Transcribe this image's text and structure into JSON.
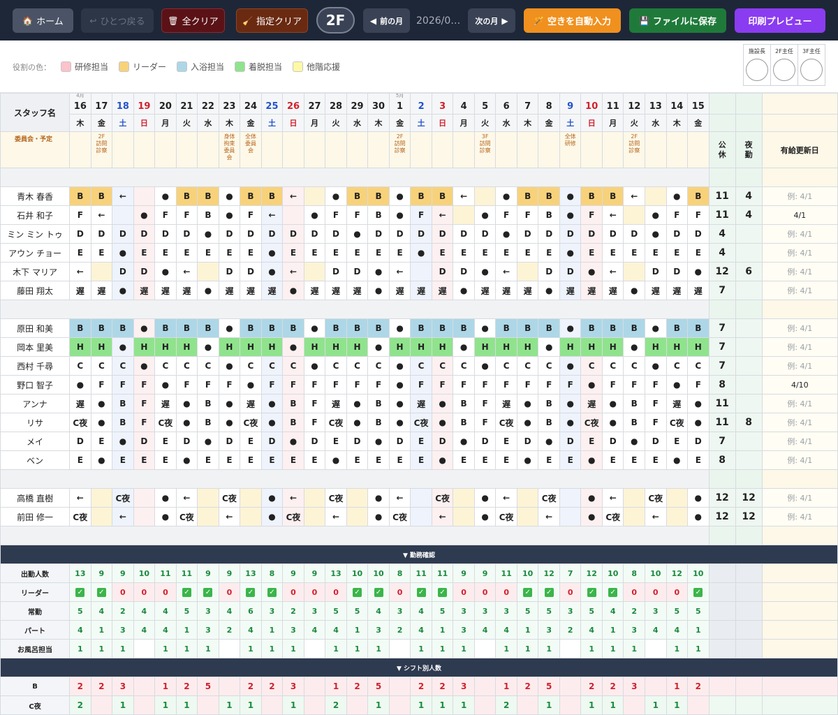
{
  "toolbar": {
    "home": "ホーム",
    "undo": "ひとつ戻る",
    "clear_all": "全クリア",
    "clear_selected": "指定クリア",
    "floor": "2F",
    "prev": "前の月",
    "month": "2026/0…",
    "next": "次の月",
    "auto_fill": "空きを自動入力",
    "save": "ファイルに保存",
    "print": "印刷プレビュー"
  },
  "legend": {
    "title": "役割の色：",
    "items": [
      {
        "label": "研修担当",
        "color": "#fbc3cb"
      },
      {
        "label": "リーダー",
        "color": "#f8d27a"
      },
      {
        "label": "入浴担当",
        "color": "#add7e7"
      },
      {
        "label": "着脱担当",
        "color": "#90e38d"
      },
      {
        "label": "他階応援",
        "color": "#fdf9a6"
      }
    ]
  },
  "stamps": [
    "施設長",
    "2F主任",
    "3F主任"
  ],
  "header": {
    "staff": "スタッフ名",
    "events_label": "委員会・予定",
    "off": "公休",
    "night": "夜勤",
    "paid_update": "有給更新日"
  },
  "days": [
    {
      "n": "16",
      "dow": "木",
      "mo": "4月",
      "t": "wk"
    },
    {
      "n": "17",
      "dow": "金",
      "t": "wk"
    },
    {
      "n": "18",
      "dow": "土",
      "t": "sat"
    },
    {
      "n": "19",
      "dow": "日",
      "t": "sun"
    },
    {
      "n": "20",
      "dow": "月",
      "t": "wk"
    },
    {
      "n": "21",
      "dow": "火",
      "t": "wk"
    },
    {
      "n": "22",
      "dow": "水",
      "t": "wk"
    },
    {
      "n": "23",
      "dow": "木",
      "t": "wk"
    },
    {
      "n": "24",
      "dow": "金",
      "t": "wk"
    },
    {
      "n": "25",
      "dow": "土",
      "t": "sat"
    },
    {
      "n": "26",
      "dow": "日",
      "t": "sun"
    },
    {
      "n": "27",
      "dow": "月",
      "t": "wk"
    },
    {
      "n": "28",
      "dow": "火",
      "t": "wk"
    },
    {
      "n": "29",
      "dow": "水",
      "t": "wk"
    },
    {
      "n": "30",
      "dow": "木",
      "t": "wk"
    },
    {
      "n": "1",
      "dow": "金",
      "mo": "5月",
      "t": "wk"
    },
    {
      "n": "2",
      "dow": "土",
      "t": "sat"
    },
    {
      "n": "3",
      "dow": "日",
      "t": "sun"
    },
    {
      "n": "4",
      "dow": "月",
      "t": "wk"
    },
    {
      "n": "5",
      "dow": "火",
      "t": "wk"
    },
    {
      "n": "6",
      "dow": "水",
      "t": "wk"
    },
    {
      "n": "7",
      "dow": "木",
      "t": "wk"
    },
    {
      "n": "8",
      "dow": "金",
      "t": "wk"
    },
    {
      "n": "9",
      "dow": "土",
      "t": "sat"
    },
    {
      "n": "10",
      "dow": "日",
      "t": "sun"
    },
    {
      "n": "11",
      "dow": "月",
      "t": "wk"
    },
    {
      "n": "12",
      "dow": "火",
      "t": "wk"
    },
    {
      "n": "13",
      "dow": "水",
      "t": "wk"
    },
    {
      "n": "14",
      "dow": "木",
      "t": "wk"
    },
    {
      "n": "15",
      "dow": "金",
      "t": "wk"
    }
  ],
  "events": [
    "",
    "2F訪問診察",
    "",
    "",
    "",
    "",
    "",
    "身体拘束委員会",
    "全体委員会",
    "",
    "",
    "",
    "",
    "",
    "",
    "2F訪問診察",
    "",
    "",
    "",
    "3F訪問診察",
    "",
    "",
    "",
    "全体研修",
    "",
    "",
    "2F訪問診察",
    "",
    "",
    ""
  ],
  "groups": [
    {
      "rows": [
        {
          "name": "青木 春香",
          "cells": [
            "B",
            "B",
            "←",
            "",
            "●",
            "B",
            "B",
            "●",
            "B",
            "B",
            "←",
            "",
            "●",
            "B",
            "B",
            "●",
            "B",
            "B",
            "←",
            "",
            "●",
            "B",
            "B",
            "●",
            "B",
            "B",
            "←",
            "",
            "●",
            "B"
          ],
          "off": "11",
          "night": "4",
          "upd": "例: 4/1",
          "set": false,
          "role": "leader"
        },
        {
          "name": "石井 和子",
          "cells": [
            "F",
            "←",
            "",
            "●",
            "F",
            "F",
            "B",
            "●",
            "F",
            "←",
            "",
            "●",
            "F",
            "F",
            "B",
            "●",
            "F",
            "←",
            "",
            "●",
            "F",
            "F",
            "B",
            "●",
            "F",
            "←",
            "",
            "●",
            "F",
            "F"
          ],
          "off": "11",
          "night": "4",
          "upd": "4/1",
          "set": true
        },
        {
          "name": "ミン ミン トゥ",
          "cells": [
            "D",
            "D",
            "D",
            "D",
            "D",
            "D",
            "●",
            "D",
            "D",
            "D",
            "D",
            "D",
            "D",
            "●",
            "D",
            "D",
            "D",
            "D",
            "D",
            "D",
            "●",
            "D",
            "D",
            "D",
            "D",
            "D",
            "D",
            "●",
            "D",
            "D"
          ],
          "off": "4",
          "night": "",
          "upd": "例: 4/1",
          "set": false
        },
        {
          "name": "アウン チョー",
          "cells": [
            "E",
            "E",
            "●",
            "E",
            "E",
            "E",
            "E",
            "E",
            "E",
            "●",
            "E",
            "E",
            "E",
            "E",
            "E",
            "E",
            "●",
            "E",
            "E",
            "E",
            "E",
            "E",
            "E",
            "●",
            "E",
            "E",
            "E",
            "E",
            "E",
            "E"
          ],
          "off": "4",
          "night": "",
          "upd": "例: 4/1",
          "set": false
        },
        {
          "name": "木下 マリア",
          "cells": [
            "←",
            "",
            "D",
            "D",
            "●",
            "←",
            "",
            "D",
            "D",
            "●",
            "←",
            "",
            "D",
            "D",
            "●",
            "←",
            "",
            "D",
            "D",
            "●",
            "←",
            "",
            "D",
            "D",
            "●",
            "←",
            "",
            "D",
            "D",
            "●"
          ],
          "off": "12",
          "night": "6",
          "upd": "例: 4/1",
          "set": false
        },
        {
          "name": "藤田 翔太",
          "cells": [
            "遅",
            "遅",
            "●",
            "遅",
            "遅",
            "遅",
            "●",
            "遅",
            "遅",
            "遅",
            "●",
            "遅",
            "遅",
            "遅",
            "●",
            "遅",
            "遅",
            "遅",
            "●",
            "遅",
            "遅",
            "遅",
            "●",
            "遅",
            "遅",
            "遅",
            "●",
            "遅",
            "遅",
            "遅"
          ],
          "off": "7",
          "night": "",
          "upd": "例: 4/1",
          "set": false
        }
      ]
    },
    {
      "rows": [
        {
          "name": "原田 和美",
          "cells": [
            "B",
            "B",
            "B",
            "●",
            "B",
            "B",
            "B",
            "●",
            "B",
            "B",
            "B",
            "●",
            "B",
            "B",
            "B",
            "●",
            "B",
            "B",
            "B",
            "●",
            "B",
            "B",
            "B",
            "●",
            "B",
            "B",
            "B",
            "●",
            "B",
            "B"
          ],
          "off": "7",
          "night": "",
          "upd": "例: 4/1",
          "set": false,
          "role": "bath"
        },
        {
          "name": "岡本 里美",
          "cells": [
            "H",
            "H",
            "●",
            "H",
            "H",
            "H",
            "●",
            "H",
            "H",
            "H",
            "●",
            "H",
            "H",
            "H",
            "●",
            "H",
            "H",
            "H",
            "●",
            "H",
            "H",
            "H",
            "●",
            "H",
            "H",
            "H",
            "●",
            "H",
            "H",
            "H"
          ],
          "off": "7",
          "night": "",
          "upd": "例: 4/1",
          "set": false,
          "role": "dress"
        },
        {
          "name": "西村 千尋",
          "cells": [
            "C",
            "C",
            "C",
            "●",
            "C",
            "C",
            "C",
            "●",
            "C",
            "C",
            "C",
            "●",
            "C",
            "C",
            "C",
            "●",
            "C",
            "C",
            "C",
            "●",
            "C",
            "C",
            "C",
            "●",
            "C",
            "C",
            "C",
            "●",
            "C",
            "C"
          ],
          "off": "7",
          "night": "",
          "upd": "例: 4/1",
          "set": false
        },
        {
          "name": "野口 智子",
          "cells": [
            "●",
            "F",
            "F",
            "F",
            "●",
            "F",
            "F",
            "F",
            "●",
            "F",
            "F",
            "F",
            "F",
            "F",
            "F",
            "●",
            "F",
            "F",
            "F",
            "F",
            "F",
            "F",
            "F",
            "F",
            "●",
            "F",
            "F",
            "F",
            "●",
            "F"
          ],
          "off": "8",
          "night": "",
          "upd": "4/10",
          "set": true
        },
        {
          "name": "アンナ",
          "cells": [
            "遅",
            "●",
            "B",
            "F",
            "遅",
            "●",
            "B",
            "●",
            "遅",
            "●",
            "B",
            "F",
            "遅",
            "●",
            "B",
            "●",
            "遅",
            "●",
            "B",
            "F",
            "遅",
            "●",
            "B",
            "●",
            "遅",
            "●",
            "B",
            "F",
            "遅",
            "●"
          ],
          "off": "11",
          "night": "",
          "upd": "例: 4/1",
          "set": false
        },
        {
          "name": "リサ",
          "cells": [
            "C夜",
            "●",
            "B",
            "F",
            "C夜",
            "●",
            "B",
            "●",
            "C夜",
            "●",
            "B",
            "F",
            "C夜",
            "●",
            "B",
            "●",
            "C夜",
            "●",
            "B",
            "F",
            "C夜",
            "●",
            "B",
            "●",
            "C夜",
            "●",
            "B",
            "F",
            "C夜",
            "●"
          ],
          "off": "11",
          "night": "8",
          "upd": "例: 4/1",
          "set": false
        },
        {
          "name": "メイ",
          "cells": [
            "D",
            "E",
            "●",
            "D",
            "E",
            "D",
            "●",
            "D",
            "E",
            "D",
            "●",
            "D",
            "E",
            "D",
            "●",
            "D",
            "E",
            "D",
            "●",
            "D",
            "E",
            "D",
            "●",
            "D",
            "E",
            "D",
            "●",
            "D",
            "E",
            "D"
          ],
          "off": "7",
          "night": "",
          "upd": "例: 4/1",
          "set": false
        },
        {
          "name": "ベン",
          "cells": [
            "E",
            "●",
            "E",
            "E",
            "E",
            "●",
            "E",
            "E",
            "E",
            "E",
            "E",
            "E",
            "●",
            "E",
            "E",
            "E",
            "E",
            "●",
            "E",
            "E",
            "E",
            "●",
            "E",
            "E",
            "●",
            "E",
            "E",
            "E",
            "●",
            "E"
          ],
          "off": "8",
          "night": "",
          "upd": "例: 4/1",
          "set": false
        }
      ]
    },
    {
      "rows": [
        {
          "name": "高橋 直樹",
          "cells": [
            "←",
            "",
            "C夜",
            "",
            "●",
            "←",
            "",
            "C夜",
            "",
            "●",
            "←",
            "",
            "C夜",
            "",
            "●",
            "←",
            "",
            "C夜",
            "",
            "●",
            "←",
            "",
            "C夜",
            "",
            "●",
            "←",
            "",
            "C夜",
            "",
            "●"
          ],
          "off": "12",
          "night": "12",
          "upd": "例: 4/1",
          "set": false
        },
        {
          "name": "前田 修一",
          "cells": [
            "C夜",
            "",
            "←",
            "",
            "●",
            "C夜",
            "",
            "←",
            "",
            "●",
            "C夜",
            "",
            "←",
            "",
            "●",
            "C夜",
            "",
            "←",
            "",
            "●",
            "C夜",
            "",
            "←",
            "",
            "●",
            "C夜",
            "",
            "←",
            "",
            "●"
          ],
          "off": "12",
          "night": "12",
          "upd": "例: 4/1",
          "set": false
        }
      ]
    }
  ],
  "attendance": {
    "title": "▼ 勤務確認",
    "rows": [
      {
        "label": "出勤人数",
        "values": [
          "13",
          "9",
          "9",
          "10",
          "11",
          "11",
          "9",
          "9",
          "13",
          "8",
          "9",
          "9",
          "13",
          "10",
          "10",
          "8",
          "11",
          "11",
          "9",
          "9",
          "11",
          "10",
          "12",
          "7",
          "12",
          "10",
          "8",
          "10",
          "12",
          "10"
        ]
      },
      {
        "label": "リーダー",
        "values": [
          "✓",
          "✓",
          "0",
          "0",
          "0",
          "✓",
          "✓",
          "0",
          "✓",
          "✓",
          "0",
          "0",
          "0",
          "✓",
          "✓",
          "0",
          "✓",
          "✓",
          "0",
          "0",
          "0",
          "✓",
          "✓",
          "0",
          "✓",
          "✓",
          "0",
          "0",
          "0",
          "✓"
        ]
      },
      {
        "label": "常勤",
        "values": [
          "5",
          "4",
          "2",
          "4",
          "4",
          "5",
          "3",
          "4",
          "6",
          "3",
          "2",
          "3",
          "5",
          "5",
          "4",
          "3",
          "4",
          "5",
          "3",
          "3",
          "3",
          "5",
          "5",
          "3",
          "5",
          "4",
          "2",
          "3",
          "5",
          "5"
        ]
      },
      {
        "label": "パート",
        "values": [
          "4",
          "1",
          "3",
          "4",
          "4",
          "1",
          "3",
          "2",
          "4",
          "1",
          "3",
          "4",
          "4",
          "1",
          "3",
          "2",
          "4",
          "1",
          "3",
          "4",
          "4",
          "1",
          "3",
          "2",
          "4",
          "1",
          "3",
          "4",
          "4",
          "1"
        ]
      },
      {
        "label": "お風呂担当",
        "values": [
          "1",
          "1",
          "1",
          "",
          "1",
          "1",
          "1",
          "",
          "1",
          "1",
          "1",
          "",
          "1",
          "1",
          "1",
          "",
          "1",
          "1",
          "1",
          "",
          "1",
          "1",
          "1",
          "",
          "1",
          "1",
          "1",
          "",
          "1",
          "1"
        ]
      }
    ]
  },
  "shifts": {
    "title": "▼ シフト別人数",
    "rows": [
      {
        "label": "B",
        "tone": "red",
        "values": [
          "2",
          "2",
          "3",
          "",
          "1",
          "2",
          "5",
          "",
          "2",
          "2",
          "3",
          "",
          "1",
          "2",
          "5",
          "",
          "2",
          "2",
          "3",
          "",
          "1",
          "2",
          "5",
          "",
          "2",
          "2",
          "3",
          "",
          "1",
          "2"
        ]
      },
      {
        "label": "C夜",
        "tone": "green",
        "values": [
          "2",
          "",
          "1",
          "",
          "1",
          "1",
          "",
          "1",
          "1",
          "",
          "1",
          "",
          "2",
          "",
          "1",
          "",
          "1",
          "1",
          "1",
          "",
          "2",
          "",
          "1",
          "",
          "1",
          "1",
          "",
          "1",
          "1",
          ""
        ]
      }
    ]
  }
}
